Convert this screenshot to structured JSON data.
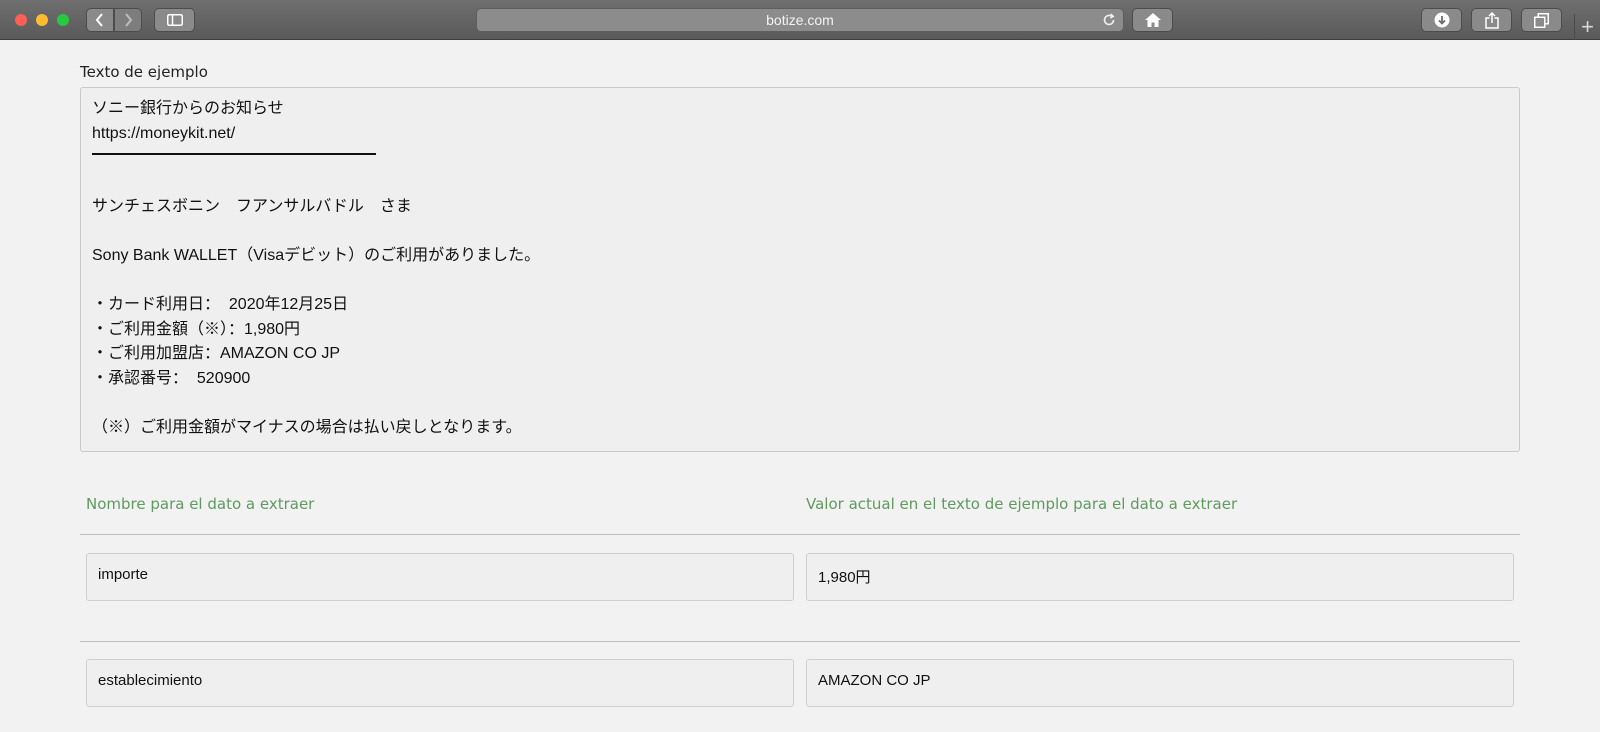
{
  "browser": {
    "url": "botize.com",
    "icons": [
      "back-icon",
      "forward-icon",
      "sidebar-icon",
      "reload-icon",
      "home-icon",
      "download-icon",
      "share-icon",
      "tabs-icon",
      "new-tab-icon"
    ]
  },
  "sample": {
    "label": "Texto de ejemplo",
    "lines": [
      "ソニー銀行からのお知らせ",
      "https://moneykit.net/",
      "",
      "",
      "サンチェスボニン　フアンサルバドル　さま",
      "",
      "Sony Bank WALLET（Visaデビット）のご利用がありました。",
      "",
      "・カード利用日：  2020年12月25日",
      "・ご利用金額（※）：1,980円",
      "・ご利用加盟店：AMAZON CO JP",
      "・承認番号：  520900",
      "",
      "（※）ご利用金額がマイナスの場合は払い戻しとなります。"
    ]
  },
  "table": {
    "header_name": "Nombre para el dato a extraer",
    "header_value": "Valor actual en el texto de ejemplo para el dato a extraer",
    "rows": [
      {
        "name": "importe",
        "value": "1,980円"
      },
      {
        "name": "establecimiento",
        "value": "AMAZON CO JP"
      }
    ]
  }
}
